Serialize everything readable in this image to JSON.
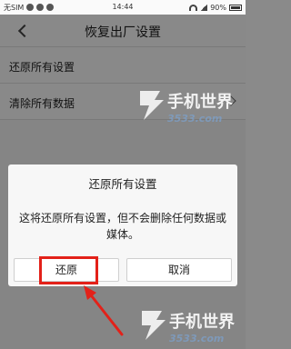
{
  "status_bar": {
    "carrier": "无SIM",
    "time": "14:44",
    "battery": "90%"
  },
  "header": {
    "title": "恢复出厂设置"
  },
  "settings": {
    "items": [
      {
        "label": "还原所有设置"
      },
      {
        "label": "清除所有数据"
      }
    ]
  },
  "dialog": {
    "title": "还原所有设置",
    "message": "这将还原所有设置，但不会删除任何数据或媒体。",
    "confirm_label": "还原",
    "cancel_label": "取消"
  },
  "watermark": {
    "brand": "手机世界",
    "site": "3533.com"
  },
  "colors": {
    "highlight": "#e32119",
    "watermark": "#7d9fc6"
  }
}
